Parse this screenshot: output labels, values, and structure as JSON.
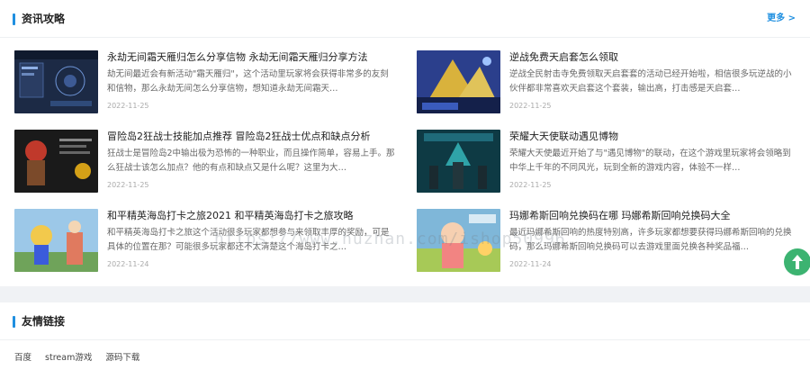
{
  "news_section": {
    "title": "资讯攻略",
    "more_label": "更多 >",
    "items": [
      {
        "title": "永劫无间霜天雁归怎么分享信物 永劫无间霜天雁归分享方法",
        "desc": "劫无间最近会有新活动\"霜天雁归\"，这个活动里玩家将会获得非常多的友刻和信物，那么永劫无间怎么分享信物，想知道永劫无间霜天…",
        "date": "2022-11-25"
      },
      {
        "title": "逆战免费天启套怎么领取",
        "desc": "逆战全民射击寺免费领取天启套套的活动已经开始啦，相信很多玩逆战的小伙伴都非常喜欢天启套这个套装，输出高，打击感是天启套…",
        "date": "2022-11-25"
      },
      {
        "title": "冒险岛2狂战士技能加点推荐 冒险岛2狂战士优点和缺点分析",
        "desc": "狂战士是冒险岛2中输出极为恐怖的一种职业，而且操作简单，容易上手。那么狂战士该怎么加点？他的有点和缺点又是什么呢？这里为大…",
        "date": "2022-11-25"
      },
      {
        "title": "荣耀大天使联动遇见博物",
        "desc": "荣耀大天使最近开始了与\"遇见博物\"的联动，在这个游戏里玩家将会领略到中华上千年的不同风光，玩到全新的游戏内容，体验不一样…",
        "date": "2022-11-25"
      },
      {
        "title": "和平精英海岛打卡之旅2021 和平精英海岛打卡之旅攻略",
        "desc": "和平精英海岛打卡之旅这个活动很多玩家都想参与来领取丰厚的奖励，可是具体的位置在那？可能很多玩家都还不太清楚这个海岛打卡之…",
        "date": "2022-11-24"
      },
      {
        "title": "玛娜希斯回响兑换码在哪 玛娜希斯回响兑换码大全",
        "desc": "最近玛娜希斯回响的热度特别高，许多玩家都想要获得玛娜希斯回响的兑换码，那么玛娜希斯回响兑换码可以去游戏里面兑换各种奖品福…",
        "date": "2022-11-24"
      }
    ]
  },
  "links_section": {
    "title": "友情链接",
    "links": [
      "百度",
      "stream游戏",
      "源码下载"
    ]
  },
  "watermark_text": "https://www.huzhan.com/ishop50996",
  "colors": {
    "accent": "#1f8fe0",
    "back_top": "#3cb371"
  },
  "icons": {
    "back_top": "arrow-up-icon"
  }
}
